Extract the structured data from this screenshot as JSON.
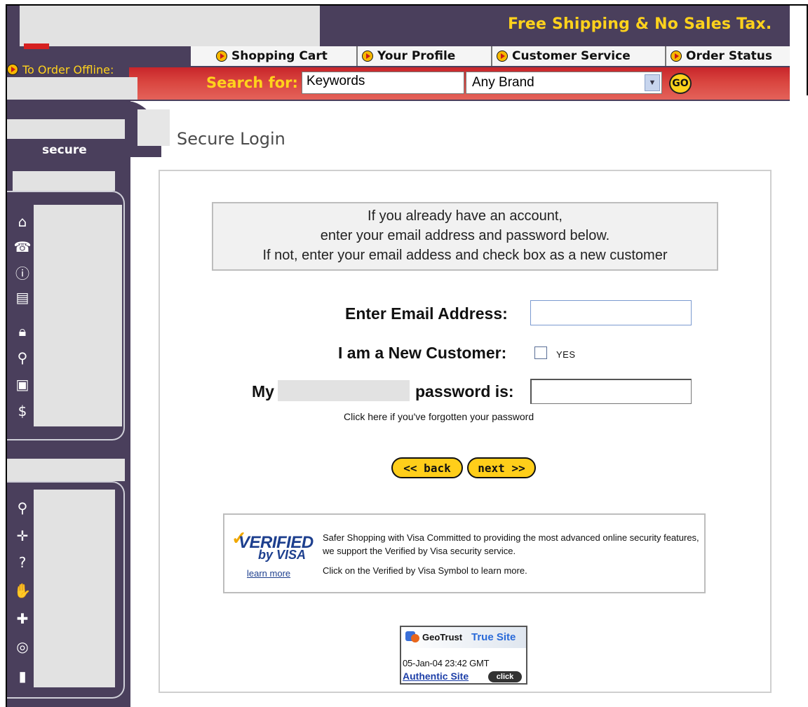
{
  "header": {
    "promo": "Free Shipping & No Sales Tax.",
    "order_offline": "To Order Offline:",
    "tabs": [
      {
        "label": "Shopping Cart"
      },
      {
        "label": "Your Profile"
      },
      {
        "label": "Customer Service"
      },
      {
        "label": "Order Status"
      }
    ]
  },
  "search": {
    "label": "Search for:",
    "keywords_value": "Keywords",
    "brand_selected": "Any Brand",
    "go_label": "GO"
  },
  "sidebar": {
    "secure_label": "secure",
    "group1_icons": [
      "home-icon",
      "phone-icon",
      "info-icon",
      "scroll-icon",
      "lock-icon",
      "magnifier-icon",
      "computer-icon",
      "dollar-icon"
    ],
    "group2_icons": [
      "magnifier-icon",
      "compass-icon",
      "help-icon",
      "handshake-icon",
      "plus-icon",
      "money-icon",
      "mobile-phone-icon"
    ]
  },
  "main": {
    "title": "Secure Login",
    "info_lines": [
      "If you already have an account,",
      "enter your email address and password below.",
      "If not, enter your email addess and check box as a new customer"
    ],
    "email_label": "Enter Email Address:",
    "new_customer_label": "I am a New Customer:",
    "yes_label": "YES",
    "password_prefix": "My",
    "password_suffix": "password is:",
    "forgot_link": "Click here if you've forgotten your password",
    "back_button": "<< back",
    "next_button": "next >>"
  },
  "visa": {
    "logo_verified": "VERIFIED",
    "logo_byvisa": "by VISA",
    "learn_more": "learn more",
    "description": "Safer Shopping with Visa Committed to providing the most advanced online security features, we support the Verified by Visa security service.",
    "instruction": "Click on the Verified by Visa Symbol to learn more."
  },
  "geotrust": {
    "brand": "GeoTrust",
    "product": "True Site",
    "timestamp": "05-Jan-04 23:42 GMT",
    "authentic": "Authentic Site",
    "click_label": "click"
  },
  "colors": {
    "header_bg": "#4a3f5c",
    "promo_yellow": "#ffd21c",
    "search_red": "#c8252a",
    "button_yellow": "#ffce1a",
    "visa_blue": "#1d3f8e"
  }
}
